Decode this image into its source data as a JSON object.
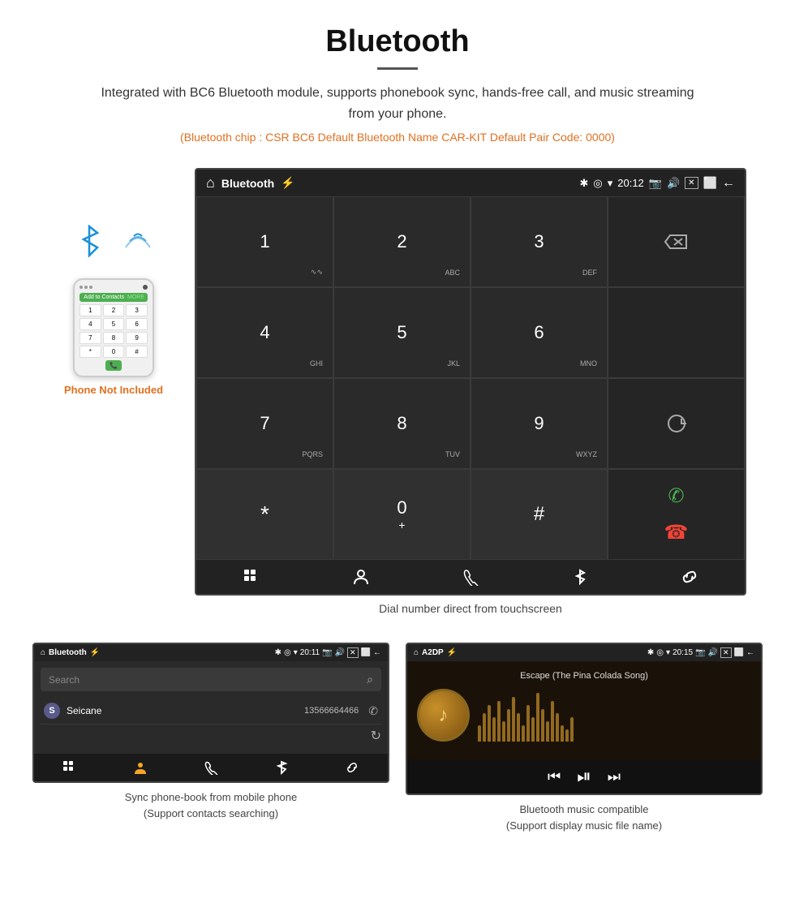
{
  "header": {
    "title": "Bluetooth",
    "description": "Integrated with BC6 Bluetooth module, supports phonebook sync, hands-free call, and music streaming from your phone.",
    "specs": "(Bluetooth chip : CSR BC6    Default Bluetooth Name CAR-KIT    Default Pair Code: 0000)"
  },
  "phone_mockup": {
    "not_included": "Phone Not Included",
    "add_to_contacts": "Add to Contacts",
    "more": "MORE"
  },
  "main_screen": {
    "status_bar": {
      "title": "Bluetooth",
      "time": "20:12"
    },
    "dial_caption": "Dial number direct from touchscreen",
    "keys": [
      {
        "number": "1",
        "sub": "∿∿"
      },
      {
        "number": "2",
        "sub": "ABC"
      },
      {
        "number": "3",
        "sub": "DEF"
      },
      {
        "number": "",
        "sub": ""
      },
      {
        "number": "4",
        "sub": "GHI"
      },
      {
        "number": "5",
        "sub": "JKL"
      },
      {
        "number": "6",
        "sub": "MNO"
      },
      {
        "number": "",
        "sub": ""
      },
      {
        "number": "7",
        "sub": "PQRS"
      },
      {
        "number": "8",
        "sub": "TUV"
      },
      {
        "number": "9",
        "sub": "WXYZ"
      },
      {
        "number": "",
        "sub": ""
      },
      {
        "number": "*",
        "sub": ""
      },
      {
        "number": "0",
        "sub": "+"
      },
      {
        "number": "#",
        "sub": ""
      },
      {
        "number": "",
        "sub": ""
      }
    ]
  },
  "phonebook_screen": {
    "status_bar": {
      "title": "Bluetooth",
      "time": "20:11"
    },
    "search_placeholder": "Search",
    "contacts": [
      {
        "letter": "S",
        "name": "Seicane",
        "number": "13566664466"
      }
    ],
    "caption_line1": "Sync phone-book from mobile phone",
    "caption_line2": "(Support contacts searching)"
  },
  "music_screen": {
    "status_bar": {
      "title": "A2DP",
      "time": "20:15"
    },
    "song_title": "Escape (The Pina Colada Song)",
    "caption_line1": "Bluetooth music compatible",
    "caption_line2": "(Support display music file name)"
  },
  "icons": {
    "home": "⌂",
    "usb": "⚓",
    "bluetooth_sym": "₿",
    "location": "◈",
    "wifi": "▼",
    "camera": "□",
    "volume": "◁",
    "close": "✕",
    "windows": "⬜",
    "back": "←",
    "backspace": "⌫",
    "refresh": "↻",
    "call_green": "✆",
    "call_red": "☎",
    "grid": "⋮⋮",
    "person": "♟",
    "phone_icon": "☏",
    "bt_icon": "✦",
    "link": "⚯",
    "search": "⌕",
    "prev": "⏮",
    "play_pause": "⏯",
    "next": "⏭",
    "music_note": "♪"
  }
}
